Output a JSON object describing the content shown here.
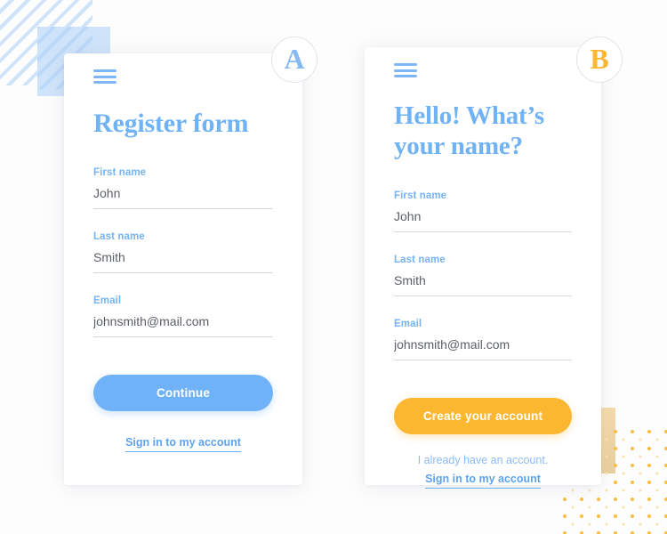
{
  "page": {
    "background_color": "#fdfdfd",
    "accent_blue": "#70b2f7",
    "accent_orange": "#fcb731"
  },
  "decor": {
    "stripes_name": "diagonal-stripes-pattern",
    "blue_square_name": "blue-square-block",
    "dots_name": "orange-dot-grid-pattern",
    "orange_square_name": "orange-square-block"
  },
  "cards": [
    {
      "id": "register",
      "menu_icon": "hamburger-menu-icon",
      "avatar_letter": "A",
      "avatar_color": "#85b9f2",
      "title": "Register form",
      "fields": [
        {
          "label": "First name",
          "value": "John",
          "placeholder": "First name"
        },
        {
          "label": "Last name",
          "value": "Smith",
          "placeholder": "Last name"
        },
        {
          "label": "Email",
          "value": "johnsmith@mail.com",
          "placeholder": "Email"
        }
      ],
      "button_label": "Continue",
      "footer_note": "",
      "footer_link": "Sign in to my account"
    },
    {
      "id": "hello",
      "menu_icon": "hamburger-menu-icon",
      "avatar_letter": "B",
      "avatar_color": "#fcb731",
      "title": "Hello! What’s your name?",
      "fields": [
        {
          "label": "First name",
          "value": "John",
          "placeholder": "First name"
        },
        {
          "label": "Last name",
          "value": "Smith",
          "placeholder": "Last name"
        },
        {
          "label": "Email",
          "value": "johnsmith@mail.com",
          "placeholder": "Email"
        }
      ],
      "button_label": "Create your account",
      "footer_note": "I already have an account.",
      "footer_link": "Sign in to my account"
    }
  ]
}
